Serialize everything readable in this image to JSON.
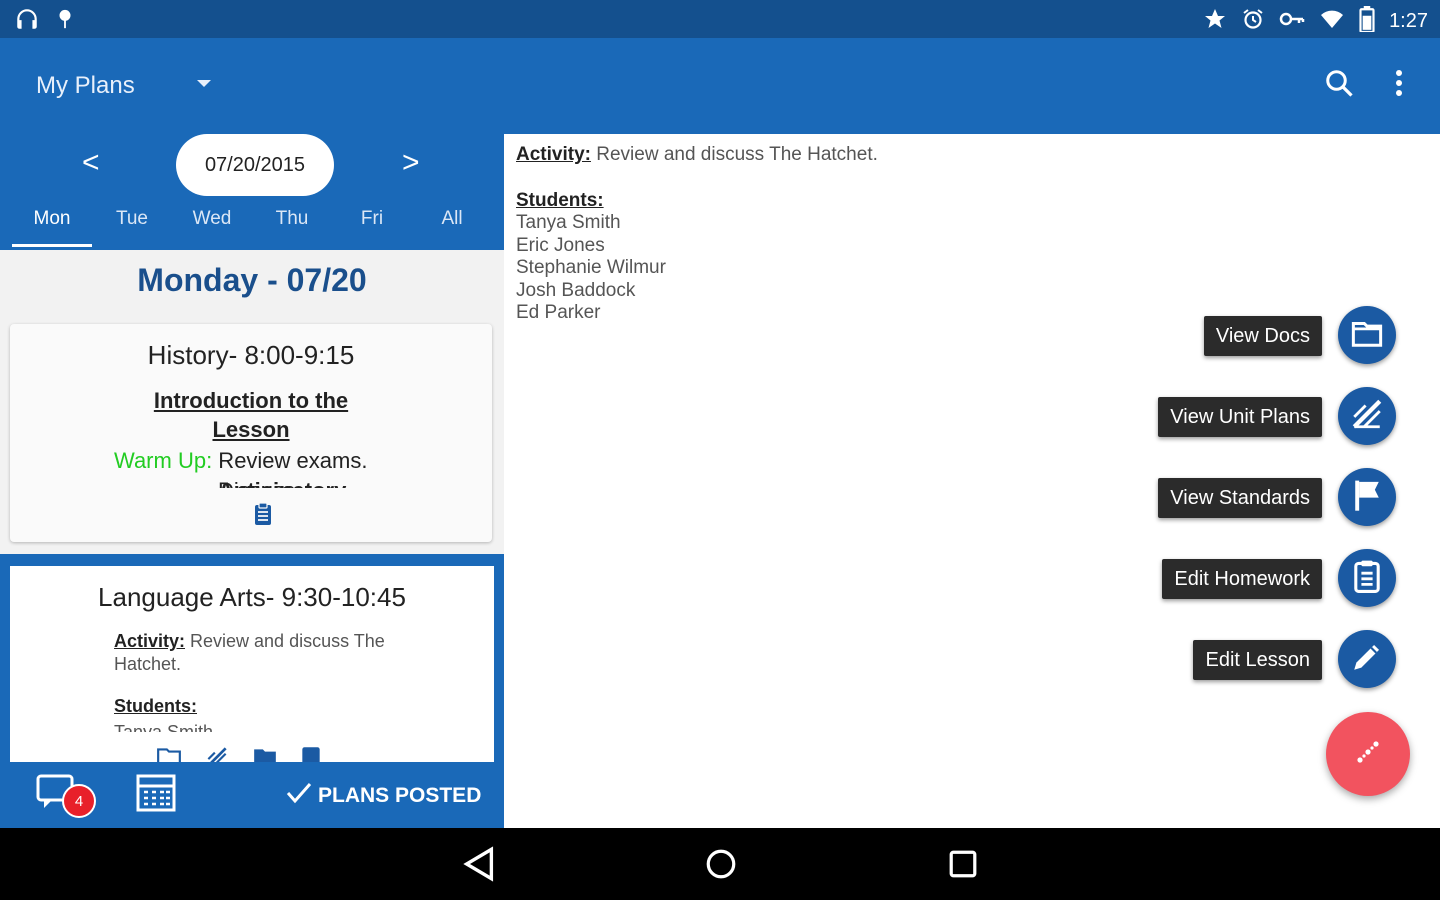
{
  "status_bar": {
    "time": "1:27",
    "left_icons": [
      "headphones-icon",
      "pin-icon"
    ],
    "right_icons": [
      "star-icon",
      "alarm-icon",
      "key-icon",
      "wifi-icon",
      "battery-icon"
    ]
  },
  "app_bar": {
    "title": "My Plans",
    "actions": [
      "search-icon",
      "more-vert-icon"
    ]
  },
  "date_nav": {
    "prev_label": "<",
    "next_label": ">",
    "date": "07/20/2015",
    "tabs": [
      {
        "label": "Mon",
        "active": true
      },
      {
        "label": "Tue",
        "active": false
      },
      {
        "label": "Wed",
        "active": false
      },
      {
        "label": "Thu",
        "active": false
      },
      {
        "label": "Fri",
        "active": false
      },
      {
        "label": "All",
        "active": false
      }
    ]
  },
  "day_heading": "Monday - 07/20",
  "lessons": [
    {
      "title": "History- 8:00-9:15",
      "subtitle_line1": "Introduction to the",
      "subtitle_line2": "Lesson",
      "warm_up_label": "Warm Up:",
      "warm_up_text": " Review exams.",
      "clipped_label": "Anticipatory Set:",
      "clipped_text": " Discuss"
    },
    {
      "title": "Language Arts- 9:30-10:45",
      "activity_label": "Activity:",
      "activity_text": " Review and discuss The Hatchet.",
      "students_label": "Students:",
      "clipped_student": "Tanya Smith"
    }
  ],
  "bottom_bar": {
    "badge_count": "4",
    "posted_label": "PLANS POSTED"
  },
  "detail": {
    "activity_label": "Activity:",
    "activity_text": " Review and discuss The Hatchet.",
    "students_label": "Students:",
    "students": [
      "Tanya Smith",
      "Eric Jones",
      "Stephanie Wilmur",
      "Josh Baddock",
      "Ed Parker"
    ]
  },
  "fab_menu": [
    {
      "label": "View Docs",
      "icon": "folder-icon"
    },
    {
      "label": "View Unit Plans",
      "icon": "edit-note-icon"
    },
    {
      "label": "View Standards",
      "icon": "flag-icon"
    },
    {
      "label": "Edit Homework",
      "icon": "clipboard-icon"
    },
    {
      "label": "Edit Lesson",
      "icon": "pencil-icon"
    }
  ],
  "colors": {
    "status_bar": "#14508e",
    "app_bar": "#1a69b8",
    "heading": "#1a4f8c",
    "fab_mini": "#1b5aa3",
    "fab_main": "#f2535f",
    "warm_up": "#22cc22",
    "badge": "#e8202a"
  }
}
